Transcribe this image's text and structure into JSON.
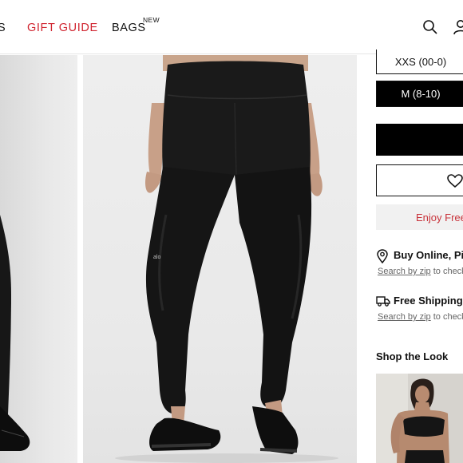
{
  "header": {
    "nav": {
      "cut_label": "S",
      "gift_label": "GIFT GUIDE",
      "bags_label": "BAGS",
      "bags_badge": "NEW"
    },
    "icons": [
      "search-icon",
      "account-icon"
    ],
    "accent_color": "#d0242f"
  },
  "product": {
    "sizes": [
      {
        "label": "XXS (00-0)",
        "selected": false
      },
      {
        "label": "M (8-10)",
        "selected": true
      }
    ],
    "promo_text": "Enjoy Free"
  },
  "fulfillment": {
    "pickup_title": "Buy Online, Pic",
    "pickup_link": "Search by zip",
    "pickup_tail": "to check",
    "ship_title": "Free Shipping",
    "ship_link": "Search by zip",
    "ship_tail": "to check"
  },
  "shop_the_look": {
    "heading": "Shop the Look"
  }
}
